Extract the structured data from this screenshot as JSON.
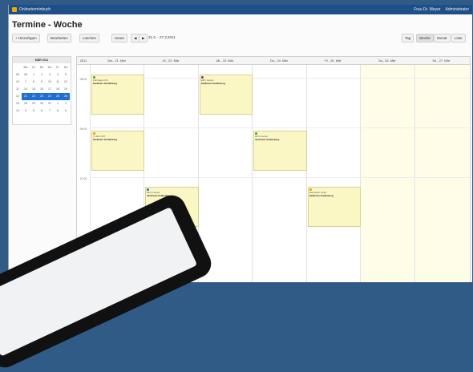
{
  "app": {
    "brand": "Onlineterminbuch",
    "user": "Frau Dr. Meyer",
    "role": "Administrator"
  },
  "page": {
    "title": "Termine - Woche"
  },
  "toolbar": {
    "add": "+ Hinzufügen",
    "edit": "Bearbeiten",
    "delete": "Löschen",
    "today": "Heute",
    "range": "21.3. - 27.3.2011",
    "views": [
      "Tag",
      "Woche",
      "Monat",
      "Liste"
    ]
  },
  "mini_calendar": {
    "month": "MÄR 2011",
    "weekdays": [
      "",
      "Mo",
      "Di",
      "Mi",
      "Do",
      "Fr",
      "Sa"
    ],
    "rows": [
      [
        "09",
        "28",
        "1",
        "2",
        "3",
        "4",
        "5"
      ],
      [
        "10",
        "7",
        "8",
        "9",
        "10",
        "11",
        "12"
      ],
      [
        "11",
        "14",
        "15",
        "16",
        "17",
        "18",
        "19"
      ],
      [
        "12",
        "21",
        "22",
        "23",
        "24",
        "25",
        "26"
      ],
      [
        "13",
        "28",
        "29",
        "30",
        "31",
        "1",
        "2"
      ],
      [
        "14",
        "4",
        "5",
        "6",
        "7",
        "8",
        "9"
      ]
    ]
  },
  "week": {
    "year": "2011",
    "days": [
      "Mo., 21. Mär",
      "Di., 22. Mär",
      "Mi., 23. Mär",
      "Do., 24. Mär",
      "Fr., 25. Mär",
      "Sa., 26. Mär",
      "So., 27. Mär"
    ],
    "hours": [
      "08:00",
      "09:00",
      "10:00"
    ]
  },
  "events": [
    {
      "day": 0,
      "text": "Fahrtagen Pro",
      "name": "Stolhrein Grellerberg"
    },
    {
      "day": 0,
      "text": "T Hilfe OPT",
      "name": "Stolhrein Grellerberg"
    },
    {
      "day": 1,
      "text": "EDV Heuter",
      "name": "Stolhrein Grellerberg"
    },
    {
      "day": 2,
      "text": "EDV Heuter",
      "name": "Stolhrein Grellerberg"
    },
    {
      "day": 3,
      "text": "EDV Heuter",
      "name": "Stolhrein Grellerberg"
    },
    {
      "day": 4,
      "text": "Sebastian Goler",
      "name": "Stolhrein Grellerberg"
    }
  ]
}
